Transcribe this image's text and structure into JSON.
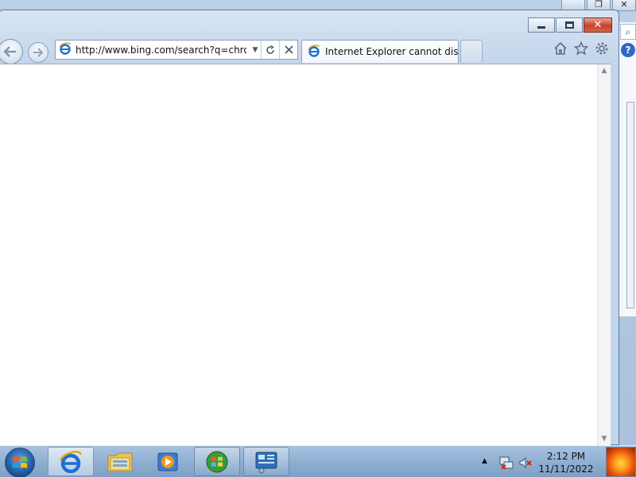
{
  "browser": {
    "address_value": "http://www.bing.com/search?q=chrome",
    "tab_title": "Internet Explorer cannot displ...",
    "back_icon": "back-arrow-icon",
    "forward_icon": "forward-arrow-icon",
    "refresh_icon": "refresh-icon",
    "stop_icon": "stop-icon",
    "home_icon": "home-icon",
    "favorites_icon": "favorites-star-icon",
    "tools_icon": "gear-icon"
  },
  "caption": {
    "minimize": "minimize",
    "maximize": "maximize",
    "close": "✕"
  },
  "background_window": {
    "close_glyph": "✕",
    "restore_glyph": "❐",
    "search_glyph": "⌕",
    "help_glyph": "?"
  },
  "taskbar": {
    "time": "2:12 PM",
    "date": "11/11/2022",
    "buttons": [
      "start",
      "internet-explorer",
      "windows-explorer",
      "media-player",
      "windows-update",
      "control-panel"
    ]
  },
  "colors": {
    "close_red": "#c5412b",
    "ie_blue": "#1e6fd0",
    "taskbar": "#8fb0d3"
  }
}
